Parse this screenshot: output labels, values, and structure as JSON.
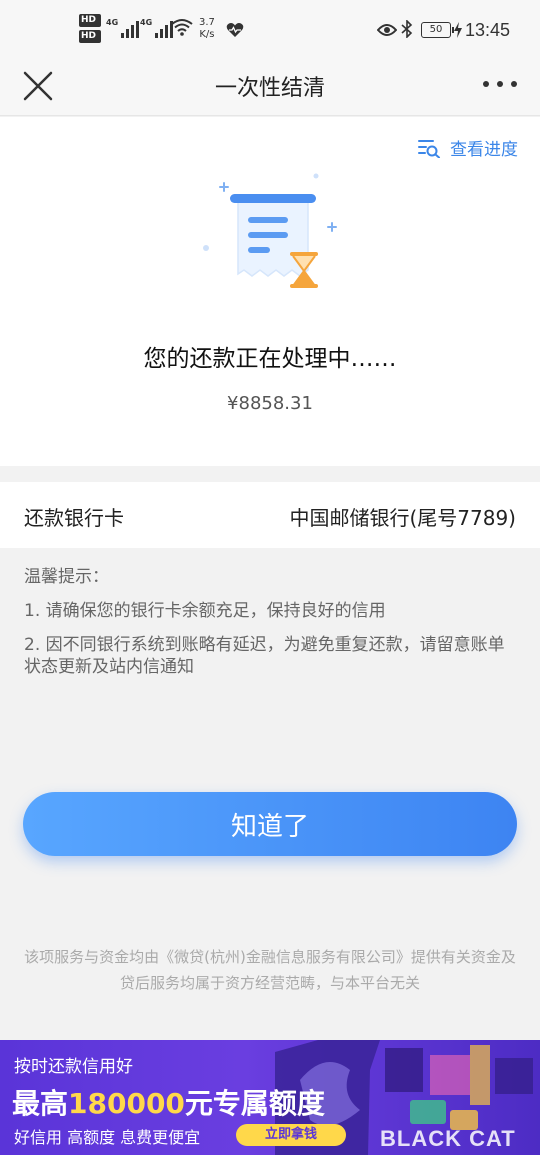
{
  "status_bar": {
    "hd1": "HD",
    "hd2": "HD",
    "net1": "4G",
    "net2": "4G",
    "speed_value": "3.7",
    "speed_unit": "K/s",
    "battery": "50",
    "time": "13:45"
  },
  "header": {
    "title": "一次性结清"
  },
  "status_card": {
    "progress_link": "查看进度",
    "title": "您的还款正在处理中……",
    "amount": "¥8858.31"
  },
  "bank": {
    "label": "还款银行卡",
    "value": "中国邮储银行(尾号7789)"
  },
  "tips": {
    "title": "温馨提示：",
    "items": [
      "1. 请确保您的银行卡余额充足，保持良好的信用",
      "2. 因不同银行系统到账略有延迟，为避免重复还款，请留意账单状态更新及站内信通知"
    ]
  },
  "confirm_button": "知道了",
  "disclaimer": "该项服务与资金均由《微贷(杭州)金融信息服务有限公司》提供有关资金及贷后服务均属于资方经营范畴，与本平台无关",
  "ad": {
    "line1": "按时还款信用好",
    "line2_prefix": "最高",
    "line2_highlight": "180000",
    "line2_suffix": "元专属额度",
    "line3": "好信用 高额度 息费更便宜",
    "button": "立即拿钱",
    "watermark": "BLACK CAT"
  },
  "colors": {
    "accent": "#3d84f2",
    "link": "#3b86e8",
    "ad_bg": "#5a34d8",
    "ad_highlight": "#ffd84a"
  }
}
